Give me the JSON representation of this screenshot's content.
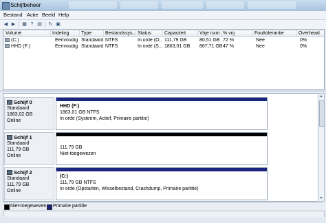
{
  "window": {
    "title": "Schijfbeheer"
  },
  "menu": [
    "Bestand",
    "Actie",
    "Beeld",
    "Help"
  ],
  "toolbar": {
    "icons": [
      "back-arrow-icon",
      "forward-arrow-icon",
      "console-tree-icon",
      "help-icon",
      "properties-icon",
      "refresh-icon",
      "help-topics-icon"
    ]
  },
  "volume_list": {
    "columns": [
      "Volume",
      "Indeling",
      "Type",
      "Bestandssys...",
      "Status",
      "Capaciteit",
      "Vrije ruim...",
      "% vrij",
      "Fouttolerantie",
      "Overhead"
    ],
    "rows": [
      [
        "(C:)",
        "Eenvoudig",
        "Standaard",
        "NTFS",
        "In orde (O...",
        "111,79 GB",
        "80,51 GB",
        "72 %",
        "Nee",
        "0%"
      ],
      [
        "HHD (F:)",
        "Eenvoudig",
        "Standaard",
        "NTFS",
        "In orde (S...",
        "1863,01 GB",
        "867,71 GB",
        "47 %",
        "Nee",
        "0%"
      ]
    ]
  },
  "disks": [
    {
      "name": "Schijf 0",
      "type": "Standaard",
      "size": "1863,02 GB",
      "status": "Online",
      "partition": {
        "name": "HHD  (F:)",
        "line1": "1863,01 GB NTFS",
        "line2": "In orde (Systeem, Actief, Primaire partitie)",
        "kind": "primary"
      }
    },
    {
      "name": "Schijf 1",
      "type": "Standaard",
      "size": "111,79 GB",
      "status": "Online",
      "partition": {
        "name": "",
        "line1": "111,79 GB",
        "line2": "Niet-toegewezen",
        "kind": "unallocated"
      }
    },
    {
      "name": "Schijf 2",
      "type": "Standaard",
      "size": "111,79 GB",
      "status": "Online",
      "partition": {
        "name": "(C:)",
        "line1": "111,79 GB NTFS",
        "line2": "In orde (Opstarten, Wisselbestand, Crashdump, Primaire partitie)",
        "kind": "primary"
      }
    }
  ],
  "legend": {
    "unallocated": "Niet-toegewezen",
    "primary": "Primaire partitie"
  },
  "colors": {
    "primary": "#1a237e",
    "unallocated": "#000000",
    "title_bar": "#b9cfe6"
  }
}
